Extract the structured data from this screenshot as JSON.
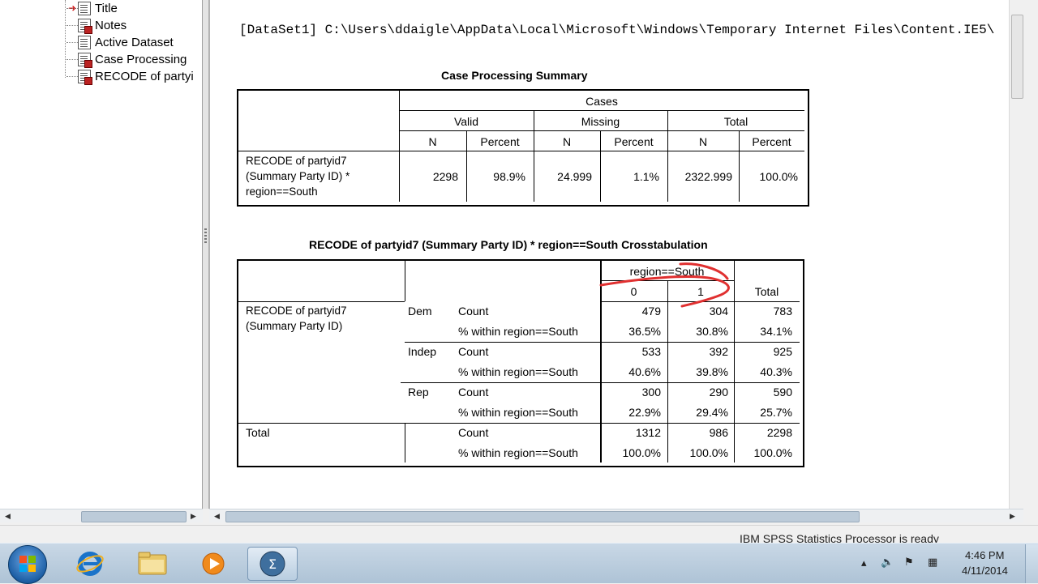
{
  "nav": {
    "items": [
      {
        "label": "Title"
      },
      {
        "label": "Notes"
      },
      {
        "label": "Active Dataset"
      },
      {
        "label": "Case Processing"
      },
      {
        "label": "RECODE of partyi"
      }
    ]
  },
  "output": {
    "dataset_line": "[DataSet1] C:\\Users\\ddaigle\\AppData\\Local\\Microsoft\\Windows\\Temporary Internet Files\\Content.IE5\\",
    "cps": {
      "title": "Case Processing Summary",
      "cases": "Cases",
      "valid": "Valid",
      "missing": "Missing",
      "total": "Total",
      "n": "N",
      "percent": "Percent",
      "row_label": "RECODE of partyid7\n(Summary Party ID) *\nregion==South",
      "valid_n": "2298",
      "valid_pct": "98.9%",
      "missing_n": "24.999",
      "missing_pct": "1.1%",
      "total_n": "2322.999",
      "total_pct": "100.0%"
    },
    "xtab": {
      "title": "RECODE of partyid7 (Summary Party ID) * region==South Crosstabulation",
      "col_var": "region==South",
      "col0": "0",
      "col1": "1",
      "total": "Total",
      "row_var": "RECODE of partyid7\n(Summary Party ID)",
      "count": "Count",
      "pct_within": "% within region==South",
      "rows": [
        {
          "label": "Dem",
          "count": [
            "479",
            "304",
            "783"
          ],
          "pct": [
            "36.5%",
            "30.8%",
            "34.1%"
          ]
        },
        {
          "label": "Indep",
          "count": [
            "533",
            "392",
            "925"
          ],
          "pct": [
            "40.6%",
            "39.8%",
            "40.3%"
          ]
        },
        {
          "label": "Rep",
          "count": [
            "300",
            "290",
            "590"
          ],
          "pct": [
            "22.9%",
            "29.4%",
            "25.7%"
          ]
        }
      ],
      "total_row": {
        "label": "Total",
        "count": [
          "1312",
          "986",
          "2298"
        ],
        "pct": [
          "100.0%",
          "100.0%",
          "100.0%"
        ]
      }
    }
  },
  "status": "IBM SPSS Statistics Processor is ready",
  "taskbar": {
    "apps": [
      "internet-explorer",
      "file-explorer",
      "media-player",
      "spss-statistics"
    ],
    "time": "4:46 PM",
    "date": "4/11/2014"
  },
  "colors": {
    "annotation": "#e03030",
    "arrow": "#d01010",
    "taskbar": "#b7cadb"
  }
}
